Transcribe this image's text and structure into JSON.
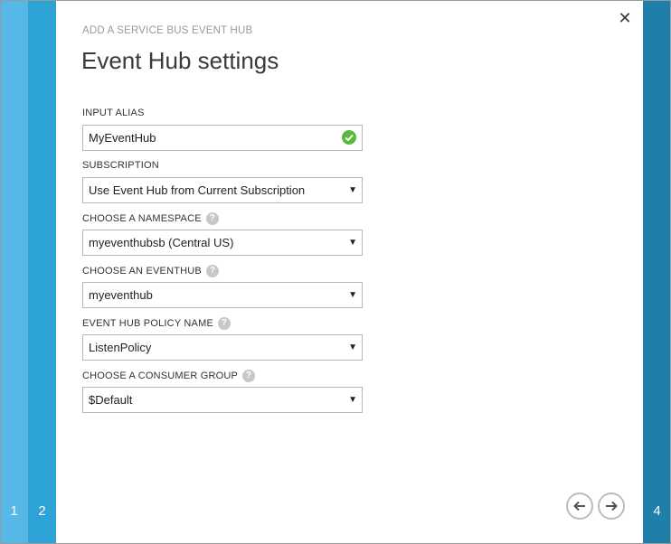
{
  "steps": [
    {
      "number": "1"
    },
    {
      "number": "2"
    },
    {
      "number": "4"
    }
  ],
  "header": {
    "subtitle": "ADD A SERVICE BUS EVENT HUB",
    "title": "Event Hub settings"
  },
  "close_icon": "close-icon",
  "fields": {
    "input_alias": {
      "label": "INPUT ALIAS",
      "value": "MyEventHub"
    },
    "subscription": {
      "label": "SUBSCRIPTION",
      "value": "Use Event Hub from Current Subscription"
    },
    "namespace": {
      "label": "CHOOSE A NAMESPACE",
      "value": "myeventhubsb (Central US)"
    },
    "eventhub": {
      "label": "CHOOSE AN EVENTHUB",
      "value": "myeventhub"
    },
    "policy": {
      "label": "EVENT HUB POLICY NAME",
      "value": "ListenPolicy"
    },
    "consumer_group": {
      "label": "CHOOSE A CONSUMER GROUP",
      "value": "$Default"
    }
  },
  "help_glyph": "?",
  "colors": {
    "step1": "#55b8e6",
    "step2": "#2ea3d6",
    "step4": "#1e7fab",
    "valid": "#5bb83c"
  }
}
